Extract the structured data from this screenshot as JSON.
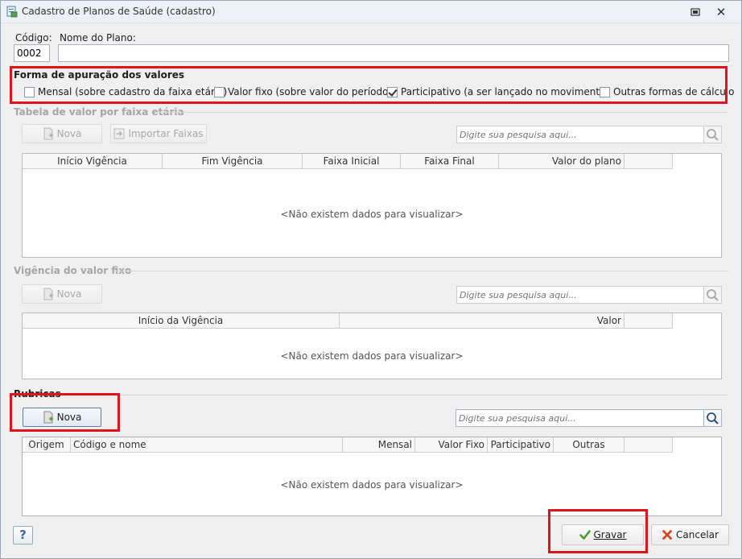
{
  "window": {
    "title": "Cadastro de Planos de Saúde (cadastro)",
    "icon": "document-window-icon",
    "restore_icon": "restore-icon",
    "close_symbol": "✕"
  },
  "form": {
    "codigo_label": "Código:",
    "codigo_value": "0002",
    "nome_label": "Nome do Plano:",
    "nome_value": ""
  },
  "apuracao": {
    "title": "Forma de apuração dos valores",
    "options": [
      {
        "label": "Mensal (sobre cadastro da faixa etária)",
        "checked": false
      },
      {
        "label": "Valor fixo (sobre valor do período)",
        "checked": false
      },
      {
        "label": "Participativo (a ser lançado no movimento)",
        "checked": true
      },
      {
        "label": "Outras formas de cálculo",
        "checked": false
      }
    ]
  },
  "faixa": {
    "title": "Tabela de valor por faixa etária",
    "nova_label": "Nova",
    "importar_label": "Importar Faixas",
    "search_placeholder": "Digite sua pesquisa aqui...",
    "columns": [
      "Início Vigência",
      "Fim Vigência",
      "Faixa Inicial",
      "Faixa Final",
      "Valor do plano"
    ],
    "empty_message": "<Não existem dados para visualizar>"
  },
  "vigencia": {
    "title": "Vigência do valor fixo",
    "nova_label": "Nova",
    "search_placeholder": "Digite sua pesquisa aqui...",
    "columns": [
      "Início da Vigência",
      "Valor"
    ],
    "empty_message": "<Não existem dados para visualizar>"
  },
  "rubricas": {
    "title": "Rubricas",
    "nova_label": "Nova",
    "search_placeholder": "Digite sua pesquisa aqui...",
    "columns": [
      "Origem",
      "Código e nome",
      "Mensal",
      "Valor Fixo",
      "Participativo",
      "Outras"
    ],
    "empty_message": "<Não existem dados para visualizar>"
  },
  "footer": {
    "help_label": "?",
    "gravar_label": "Gravar",
    "cancelar_label": "Cancelar"
  },
  "colors": {
    "highlight_red": "#e2141b",
    "check_green": "#4d9a2a",
    "cancel_red": "#d9471e"
  }
}
